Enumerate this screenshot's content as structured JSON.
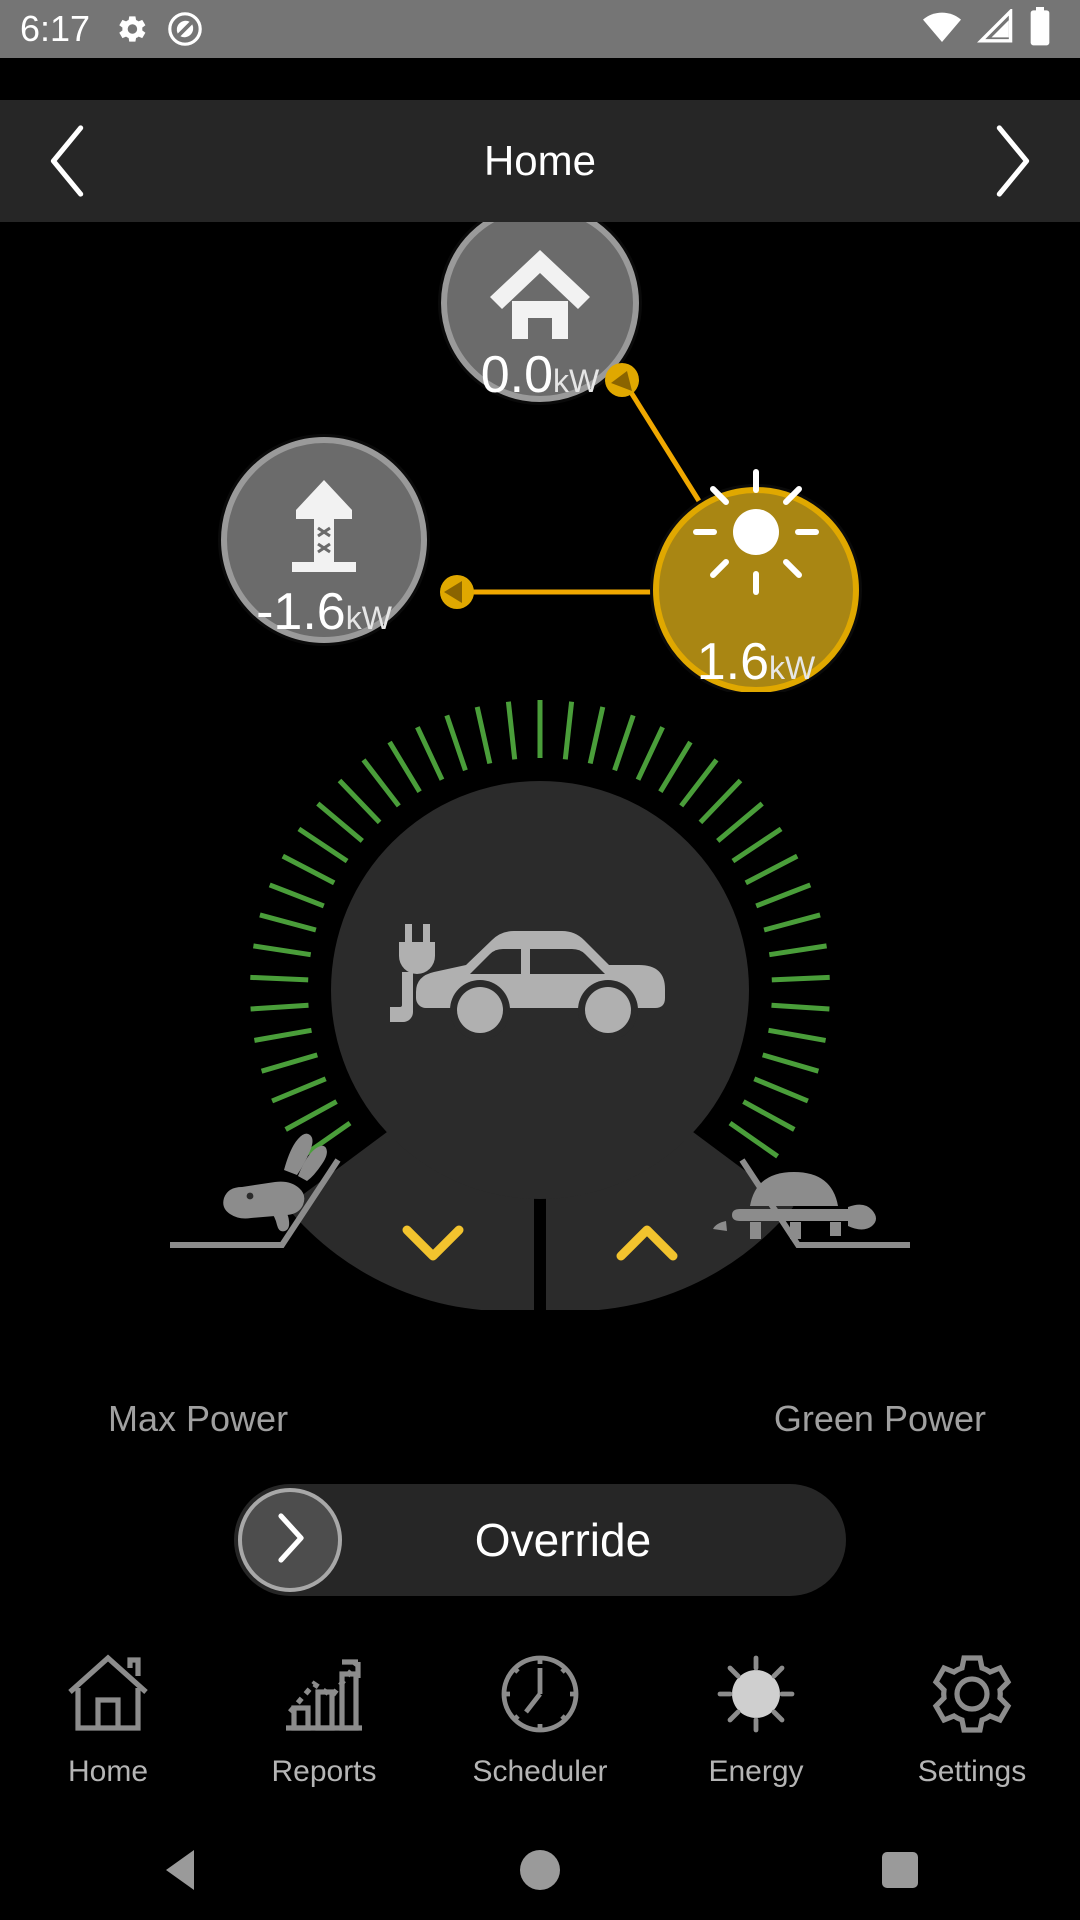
{
  "status_bar": {
    "time": "6:17",
    "left_icons": [
      "gear-icon",
      "do-not-disturb-icon"
    ],
    "right_icons": [
      "wifi-icon",
      "cellular-signal-icon",
      "battery-full-icon"
    ]
  },
  "header": {
    "title": "Home",
    "prev_label": "‹",
    "next_label": "›"
  },
  "flow": {
    "nodes": [
      {
        "id": "home",
        "icon": "house-icon",
        "value": "0.0",
        "unit": "kW",
        "state": "idle"
      },
      {
        "id": "grid",
        "icon": "power-tower-icon",
        "value": "-1.6",
        "unit": "kW",
        "state": "idle"
      },
      {
        "id": "solar",
        "icon": "sun-icon",
        "value": "1.6",
        "unit": "kW",
        "state": "active"
      }
    ],
    "links": [
      {
        "from": "solar",
        "to": "home",
        "direction": "to-home"
      },
      {
        "from": "solar",
        "to": "grid",
        "direction": "to-grid"
      }
    ],
    "colors": {
      "active": "#a98613",
      "active_border": "#e0a800",
      "idle": "#6b6b6b",
      "idle_border": "#9a9a9a",
      "flow_line": "#f0a800"
    }
  },
  "gauge": {
    "device_icon": "ev-car-charging-icon",
    "tick_color": "#4a9e3a",
    "tick_count": 41,
    "left_label": "Max Power",
    "left_icon": "rabbit-icon",
    "right_label": "Green Power",
    "right_icon": "turtle-icon",
    "decrease_icon": "chevron-down-icon",
    "increase_icon": "chevron-up-icon",
    "chevron_color": "#f2c32e"
  },
  "override": {
    "label": "Override",
    "handle_icon": "chevron-right-icon"
  },
  "bottom_nav": {
    "items": [
      {
        "label": "Home",
        "icon": "house-icon",
        "active": false
      },
      {
        "label": "Reports",
        "icon": "bar-chart-trend-icon",
        "active": false
      },
      {
        "label": "Scheduler",
        "icon": "clock-icon",
        "active": false
      },
      {
        "label": "Energy",
        "icon": "sun-icon",
        "active": true
      },
      {
        "label": "Settings",
        "icon": "gear-icon",
        "active": false
      }
    ]
  },
  "system_bar": {
    "back": "back-triangle-icon",
    "home": "home-circle-icon",
    "recents": "recents-square-icon"
  }
}
